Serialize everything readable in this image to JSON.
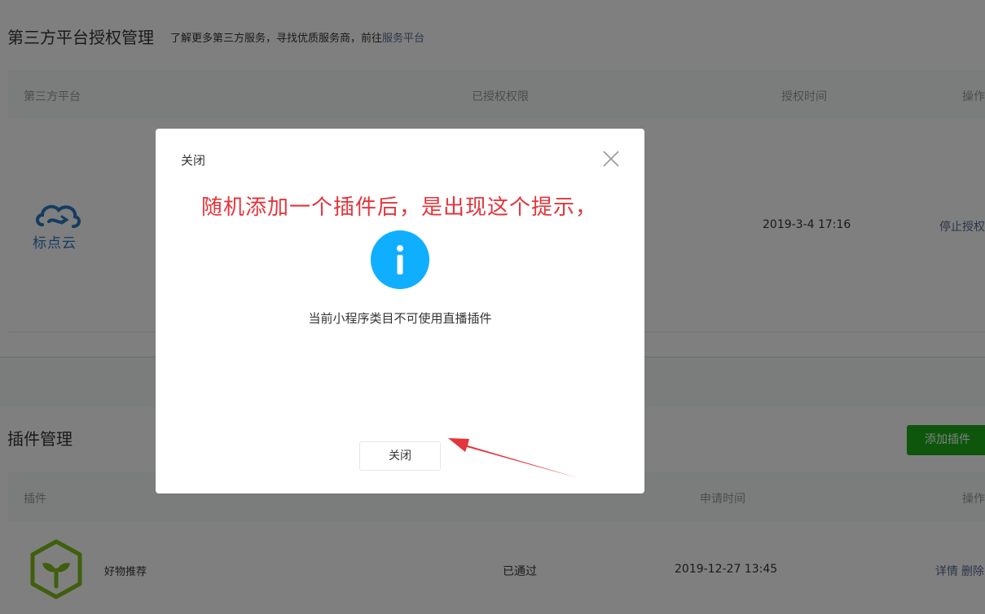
{
  "auth_section": {
    "title": "第三方平台授权管理",
    "subtitle_text": "了解更多第三方服务，寻找优质服务商，前往",
    "subtitle_link": "服务平台",
    "columns": [
      "第三方平台",
      "已授权权限",
      "授权时间",
      "操作"
    ],
    "row": {
      "platform_logo_text": "标点云",
      "time": "2019-3-4 17:16",
      "action": "停止授权"
    }
  },
  "plugin_section": {
    "title": "插件管理",
    "add_button": "添加插件",
    "columns": [
      "插件",
      "申请时间",
      "操作"
    ],
    "row": {
      "name": "好物推荐",
      "status": "已通过",
      "time": "2019-12-27 13:45",
      "actions": [
        "详情",
        "删除"
      ]
    }
  },
  "dialog": {
    "title": "关闭",
    "annotation": "随机添加一个插件后，是出现这个提示，",
    "message": "当前小程序类目不可使用直播插件",
    "button": "关闭",
    "icon": "info-icon"
  },
  "colors": {
    "link": "#576b95",
    "primary_green": "#1aad19",
    "info_blue": "#10aeff",
    "annotation_red": "#e5343b"
  }
}
